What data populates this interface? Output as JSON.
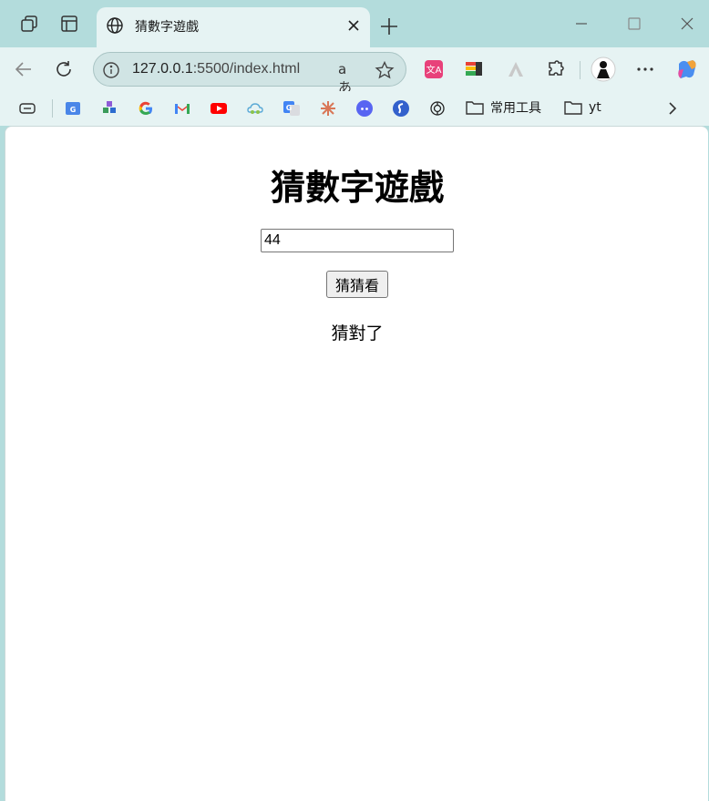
{
  "tab": {
    "title": "猜數字遊戲"
  },
  "address_bar": {
    "host": "127.0.0.1",
    "path": ":5500/index.html",
    "read_aloud_label": "aあ"
  },
  "bookmarks": {
    "folders": [
      "常用工具",
      "yt"
    ]
  },
  "page": {
    "heading": "猜數字遊戲",
    "input_value": "44",
    "button_label": "猜猜看",
    "result_text": "猜對了"
  },
  "colors": {
    "frame": "#b3dcdc",
    "toolbar": "#e6f3f3"
  }
}
